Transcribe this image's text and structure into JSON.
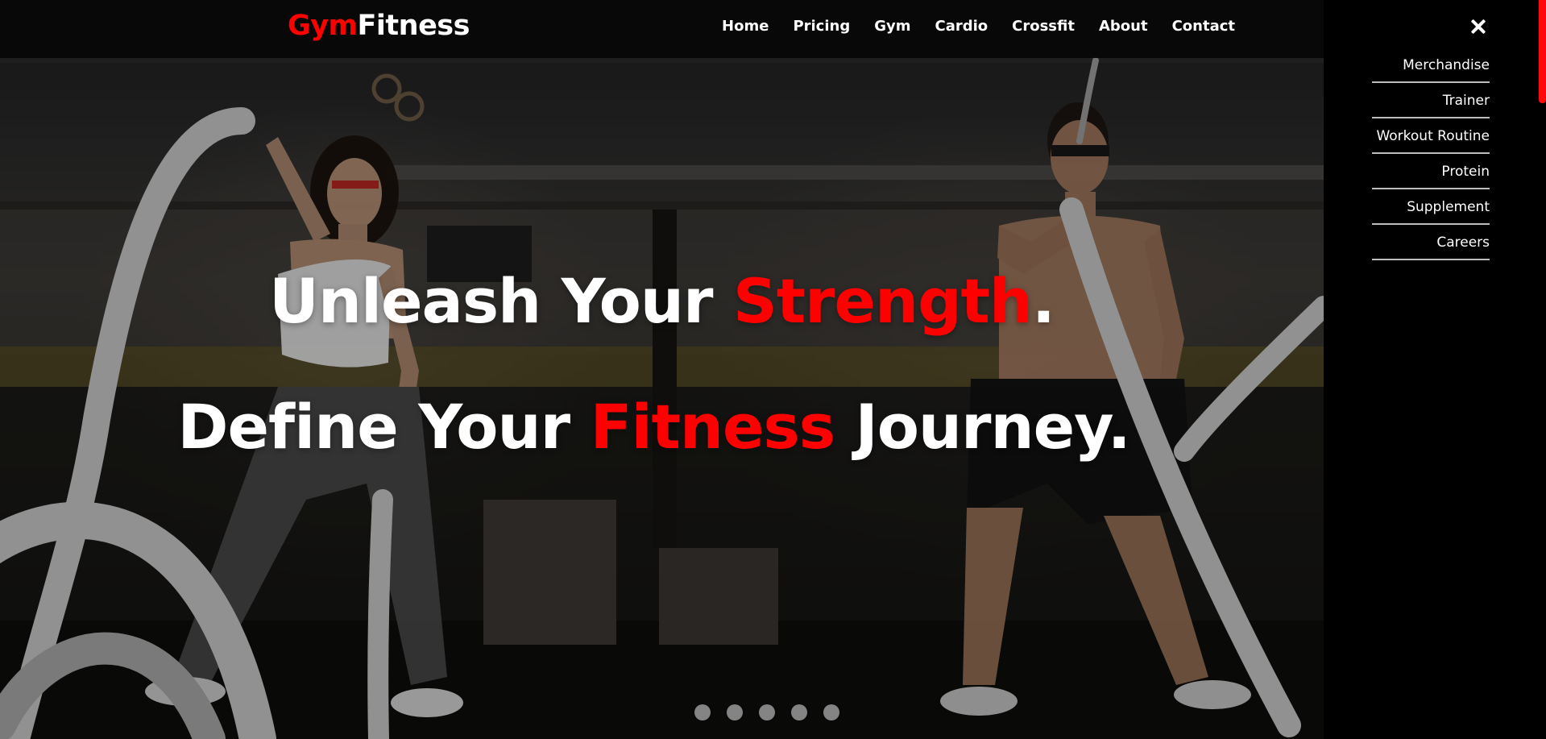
{
  "brand": {
    "part1": "Gym",
    "part2": "Fitness"
  },
  "nav": {
    "items": [
      {
        "label": "Home"
      },
      {
        "label": "Pricing"
      },
      {
        "label": "Gym"
      },
      {
        "label": "Cardio"
      },
      {
        "label": "Crossfit"
      },
      {
        "label": "About"
      },
      {
        "label": "Contact"
      }
    ]
  },
  "hero": {
    "line1": {
      "a": "Unleash Your ",
      "b": "Strength",
      "c": "."
    },
    "line2": {
      "a": "Define Your ",
      "b": "Fitness",
      "c": " Journey."
    },
    "slides_count": 5,
    "active_slide": 1
  },
  "drawer": {
    "close_icon": "close-icon",
    "items": [
      {
        "label": "Merchandise"
      },
      {
        "label": "Trainer"
      },
      {
        "label": "Workout Routine"
      },
      {
        "label": "Protein"
      },
      {
        "label": "Supplement"
      },
      {
        "label": "Careers"
      }
    ]
  },
  "colors": {
    "accent": "#ff0000",
    "nav_bg": "#080808",
    "drawer_bg": "#000000"
  }
}
